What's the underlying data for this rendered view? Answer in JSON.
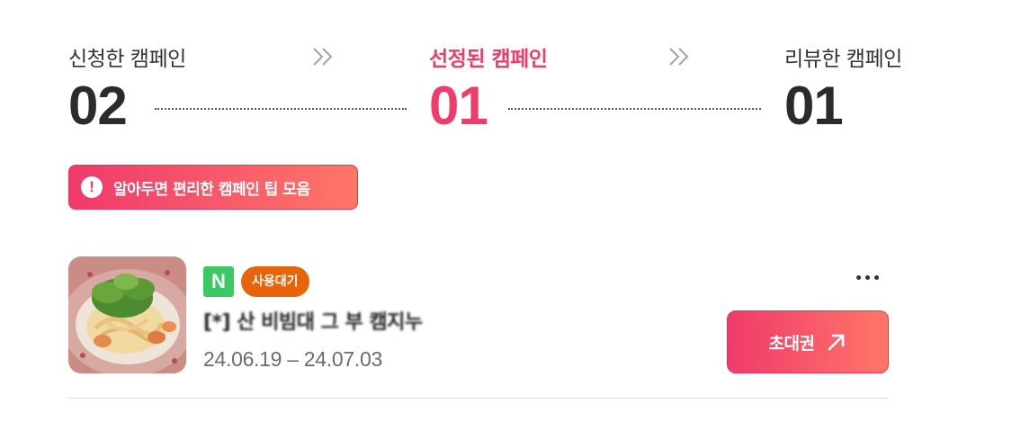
{
  "steps": [
    {
      "label": "신청한 캠페인",
      "count": "02"
    },
    {
      "label": "선정된 캠페인",
      "count": "01"
    },
    {
      "label": "리뷰한 캠페인",
      "count": "01"
    }
  ],
  "accent_color": "#ee3d6b",
  "tip": {
    "icon": "!",
    "icon_name": "alert-circle-icon",
    "label": "알아두면 편리한 캠페인 팁 모음"
  },
  "campaign": {
    "platform_badge": "N",
    "platform_icon_name": "naver-icon",
    "status": "사용대기",
    "title": "[*] 산 비빔대 그 부 캠지누",
    "period": "24.06.19 – 24.07.03",
    "more_icon_name": "more-horizontal-icon",
    "action_label": "초대권",
    "action_icon_name": "arrow-up-right-icon"
  }
}
